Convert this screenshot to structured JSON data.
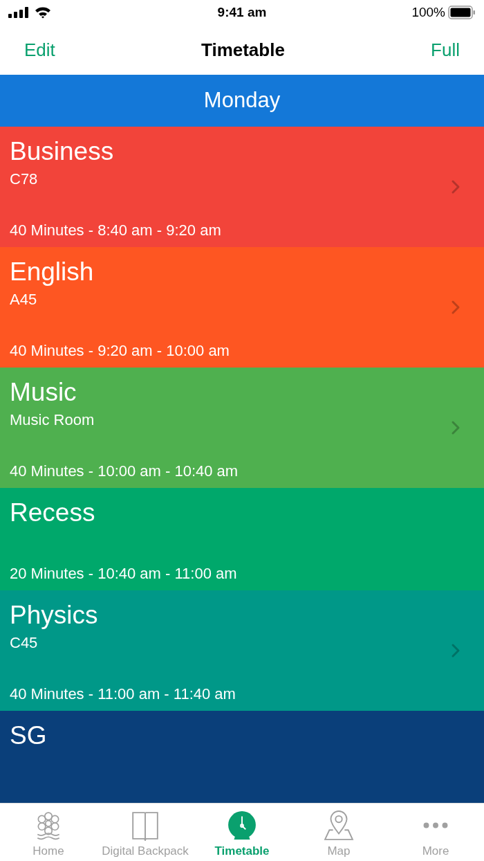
{
  "status_bar": {
    "time": "9:41 am",
    "battery": "100%"
  },
  "nav": {
    "left": "Edit",
    "title": "Timetable",
    "right": "Full"
  },
  "day": "Monday",
  "lessons": [
    {
      "title": "Business",
      "room": "C78",
      "duration": "40 Minutes - 8:40 am - 9:20 am",
      "color": "#f2443a",
      "chevron": true
    },
    {
      "title": "English",
      "room": "A45",
      "duration": "40 Minutes - 9:20 am - 10:00 am",
      "color": "#fe5622",
      "chevron": true
    },
    {
      "title": "Music",
      "room": "Music Room",
      "duration": "40 Minutes - 10:00 am - 10:40 am",
      "color": "#4fb04f",
      "chevron": true
    },
    {
      "title": "Recess",
      "duration": "20 Minutes - 10:40 am - 11:00 am",
      "color": "#00a86b",
      "chevron": false
    },
    {
      "title": "Physics",
      "room": "C45",
      "duration": "40 Minutes - 11:00 am - 11:40 am",
      "color": "#009888",
      "chevron": true
    },
    {
      "title": "SG",
      "color": "#0a3f7a",
      "chevron": false
    }
  ],
  "tabs": [
    {
      "label": "Home",
      "kind": "home",
      "selected": false
    },
    {
      "label": "Digital Backpack",
      "kind": "book",
      "selected": false
    },
    {
      "label": "Timetable",
      "kind": "clock",
      "selected": true
    },
    {
      "label": "Map",
      "kind": "map",
      "selected": false
    },
    {
      "label": "More",
      "kind": "more",
      "selected": false
    }
  ]
}
